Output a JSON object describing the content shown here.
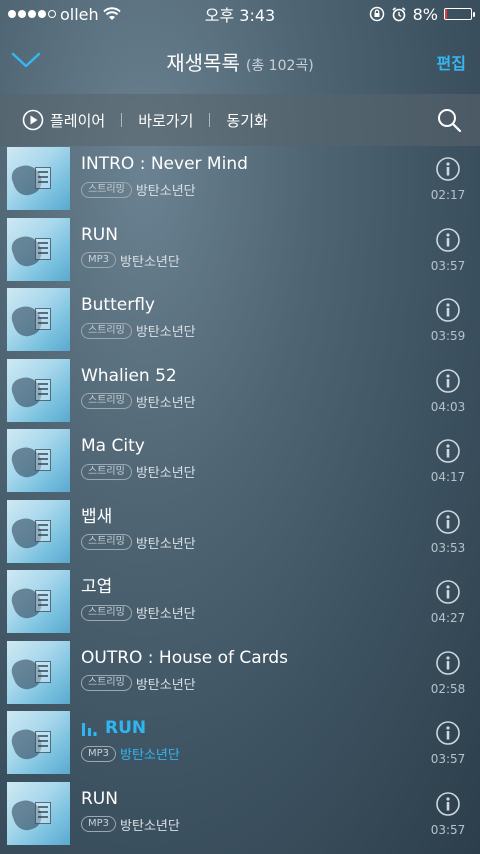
{
  "status": {
    "carrier": "olleh",
    "time": "오후 3:43",
    "battery": "8%",
    "battery_level": 0.08
  },
  "header": {
    "title": "재생목록",
    "count": "(총 102곡)",
    "edit_label": "편집"
  },
  "toolbar": {
    "player_label": "플레이어",
    "goto_label": "바로가기",
    "sync_label": "동기화"
  },
  "songs": [
    {
      "title": "INTRO : Never Mind",
      "type": "스트리밍",
      "artist": "방탄소년단",
      "duration": "02:17",
      "playing": false
    },
    {
      "title": "RUN",
      "type": "MP3",
      "artist": "방탄소년단",
      "duration": "03:57",
      "playing": false
    },
    {
      "title": "Butterfly",
      "type": "스트리밍",
      "artist": "방탄소년단",
      "duration": "03:59",
      "playing": false
    },
    {
      "title": "Whalien 52",
      "type": "스트리밍",
      "artist": "방탄소년단",
      "duration": "04:03",
      "playing": false
    },
    {
      "title": "Ma City",
      "type": "스트리밍",
      "artist": "방탄소년단",
      "duration": "04:17",
      "playing": false
    },
    {
      "title": "뱁새",
      "type": "스트리밍",
      "artist": "방탄소년단",
      "duration": "03:53",
      "playing": false
    },
    {
      "title": "고엽",
      "type": "스트리밍",
      "artist": "방탄소년단",
      "duration": "04:27",
      "playing": false
    },
    {
      "title": "OUTRO : House of Cards",
      "type": "스트리밍",
      "artist": "방탄소년단",
      "duration": "02:58",
      "playing": false
    },
    {
      "title": "RUN",
      "type": "MP3",
      "artist": "방탄소년단",
      "duration": "03:57",
      "playing": true
    },
    {
      "title": "RUN",
      "type": "MP3",
      "artist": "방탄소년단",
      "duration": "03:57",
      "playing": false
    }
  ],
  "colors": {
    "accent": "#37b6f0",
    "battery_low": "#e23b3b"
  }
}
